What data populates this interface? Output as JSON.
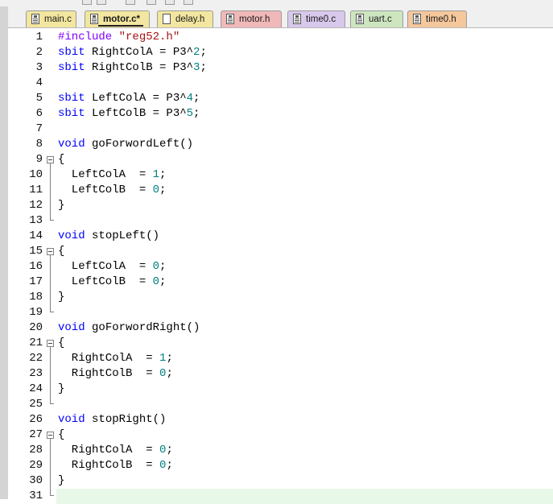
{
  "tabs": [
    {
      "label": "main.c",
      "color": "#f2e6a0",
      "active": false,
      "icon": "source-file-icon"
    },
    {
      "label": "motor.c*",
      "color": "#f2e6a0",
      "active": true,
      "icon": "source-file-icon"
    },
    {
      "label": "delay.h",
      "color": "#f2e6a0",
      "active": false,
      "icon": "header-file-icon"
    },
    {
      "label": "motor.h",
      "color": "#f0b8b8",
      "active": false,
      "icon": "header-file-icon"
    },
    {
      "label": "time0.c",
      "color": "#d8c8ec",
      "active": false,
      "icon": "source-file-icon"
    },
    {
      "label": "uart.c",
      "color": "#cde6c0",
      "active": false,
      "icon": "source-file-icon"
    },
    {
      "label": "time0.h",
      "color": "#f5c79c",
      "active": false,
      "icon": "header-file-icon"
    }
  ],
  "editor": {
    "colors": {
      "keyword": "#0000ff",
      "preprocessor": "#8000ff",
      "string": "#a31515",
      "number": "#008080",
      "current_line": "#e8f8e8"
    },
    "lines": [
      {
        "n": "1",
        "tokens": [
          {
            "t": "#include",
            "c": "pp"
          },
          {
            "t": " "
          },
          {
            "t": "\"reg52.h\"",
            "c": "str"
          }
        ]
      },
      {
        "n": "2",
        "tokens": [
          {
            "t": "sbit",
            "c": "kw"
          },
          {
            "t": " RightColA = P3^"
          },
          {
            "t": "2",
            "c": "num"
          },
          {
            "t": ";"
          }
        ]
      },
      {
        "n": "3",
        "tokens": [
          {
            "t": "sbit",
            "c": "kw"
          },
          {
            "t": " RightColB = P3^"
          },
          {
            "t": "3",
            "c": "num"
          },
          {
            "t": ";"
          }
        ]
      },
      {
        "n": "4",
        "tokens": []
      },
      {
        "n": "5",
        "tokens": [
          {
            "t": "sbit",
            "c": "kw"
          },
          {
            "t": " LeftColA = P3^"
          },
          {
            "t": "4",
            "c": "num"
          },
          {
            "t": ";"
          }
        ]
      },
      {
        "n": "6",
        "tokens": [
          {
            "t": "sbit",
            "c": "kw"
          },
          {
            "t": " LeftColB = P3^"
          },
          {
            "t": "5",
            "c": "num"
          },
          {
            "t": ";"
          }
        ]
      },
      {
        "n": "7",
        "tokens": []
      },
      {
        "n": "8",
        "tokens": [
          {
            "t": "void",
            "c": "kw"
          },
          {
            "t": " goForwordLeft()"
          }
        ]
      },
      {
        "n": "9",
        "tokens": [
          {
            "t": "{"
          }
        ]
      },
      {
        "n": "10",
        "tokens": [
          {
            "t": "  LeftColA  = "
          },
          {
            "t": "1",
            "c": "num"
          },
          {
            "t": ";"
          }
        ]
      },
      {
        "n": "11",
        "tokens": [
          {
            "t": "  LeftColB  = "
          },
          {
            "t": "0",
            "c": "num"
          },
          {
            "t": ";"
          }
        ]
      },
      {
        "n": "12",
        "tokens": [
          {
            "t": "}"
          }
        ]
      },
      {
        "n": "13",
        "tokens": []
      },
      {
        "n": "14",
        "tokens": [
          {
            "t": "void",
            "c": "kw"
          },
          {
            "t": " stopLeft()"
          }
        ]
      },
      {
        "n": "15",
        "tokens": [
          {
            "t": "{"
          }
        ]
      },
      {
        "n": "16",
        "tokens": [
          {
            "t": "  LeftColA  = "
          },
          {
            "t": "0",
            "c": "num"
          },
          {
            "t": ";"
          }
        ]
      },
      {
        "n": "17",
        "tokens": [
          {
            "t": "  LeftColB  = "
          },
          {
            "t": "0",
            "c": "num"
          },
          {
            "t": ";"
          }
        ]
      },
      {
        "n": "18",
        "tokens": [
          {
            "t": "}"
          }
        ]
      },
      {
        "n": "19",
        "tokens": []
      },
      {
        "n": "20",
        "tokens": [
          {
            "t": "void",
            "c": "kw"
          },
          {
            "t": " goForwordRight()"
          }
        ]
      },
      {
        "n": "21",
        "tokens": [
          {
            "t": "{"
          }
        ]
      },
      {
        "n": "22",
        "tokens": [
          {
            "t": "  RightColA  = "
          },
          {
            "t": "1",
            "c": "num"
          },
          {
            "t": ";"
          }
        ]
      },
      {
        "n": "23",
        "tokens": [
          {
            "t": "  RightColB  = "
          },
          {
            "t": "0",
            "c": "num"
          },
          {
            "t": ";"
          }
        ]
      },
      {
        "n": "24",
        "tokens": [
          {
            "t": "}"
          }
        ]
      },
      {
        "n": "25",
        "tokens": []
      },
      {
        "n": "26",
        "tokens": [
          {
            "t": "void",
            "c": "kw"
          },
          {
            "t": " stopRight()"
          }
        ]
      },
      {
        "n": "27",
        "tokens": [
          {
            "t": "{"
          }
        ]
      },
      {
        "n": "28",
        "tokens": [
          {
            "t": "  RightColA  = "
          },
          {
            "t": "0",
            "c": "num"
          },
          {
            "t": ";"
          }
        ]
      },
      {
        "n": "29",
        "tokens": [
          {
            "t": "  RightColB  = "
          },
          {
            "t": "0",
            "c": "num"
          },
          {
            "t": ";"
          }
        ]
      },
      {
        "n": "30",
        "tokens": [
          {
            "t": "}"
          }
        ]
      },
      {
        "n": "31",
        "tokens": []
      }
    ],
    "fold_blocks": [
      [
        9,
        12
      ],
      [
        15,
        18
      ],
      [
        21,
        24
      ],
      [
        27,
        30
      ]
    ],
    "current_line": "31"
  }
}
